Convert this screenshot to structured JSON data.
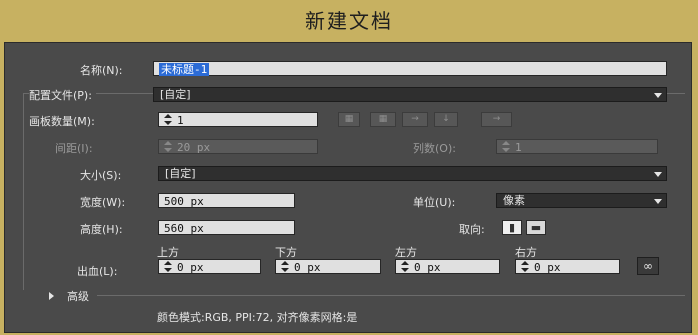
{
  "dialog": {
    "title": "新建文档"
  },
  "name": {
    "label": "名称(N):",
    "value": "未标题-1"
  },
  "profile": {
    "label": "配置文件(P):",
    "value": "[自定]"
  },
  "artboards": {
    "label": "画板数量(M):",
    "value": "1",
    "layout_icons": [
      "grid-by-row-icon",
      "grid-by-column-icon",
      "arrange-by-row-icon",
      "arrange-by-column-icon",
      "right-to-left-icon"
    ]
  },
  "spacing": {
    "label": "间距(I):",
    "value": "20 px"
  },
  "columns": {
    "label": "列数(O):",
    "value": "1"
  },
  "size": {
    "label": "大小(S):",
    "value": "[自定]"
  },
  "width": {
    "label": "宽度(W):",
    "value": "500 px"
  },
  "units": {
    "label": "单位(U):",
    "value": "像素"
  },
  "height": {
    "label": "高度(H):",
    "value": "560 px"
  },
  "orientation": {
    "label": "取向:",
    "portrait_icon": "portrait-icon",
    "landscape_icon": "landscape-icon"
  },
  "bleed": {
    "label": "出血(L):",
    "top": {
      "label": "上方",
      "value": "0 px"
    },
    "bottom": {
      "label": "下方",
      "value": "0 px"
    },
    "left": {
      "label": "左方",
      "value": "0 px"
    },
    "right": {
      "label": "右方",
      "value": "0 px"
    },
    "link_icon": "link-icon"
  },
  "advanced": {
    "label": "高级"
  },
  "summary": "颜色模式:RGB, PPI:72, 对齐像素网格:是",
  "colors": {
    "frame": "#c7b161",
    "panel": "#4a4a4a",
    "selection": "#2b6bd6"
  }
}
